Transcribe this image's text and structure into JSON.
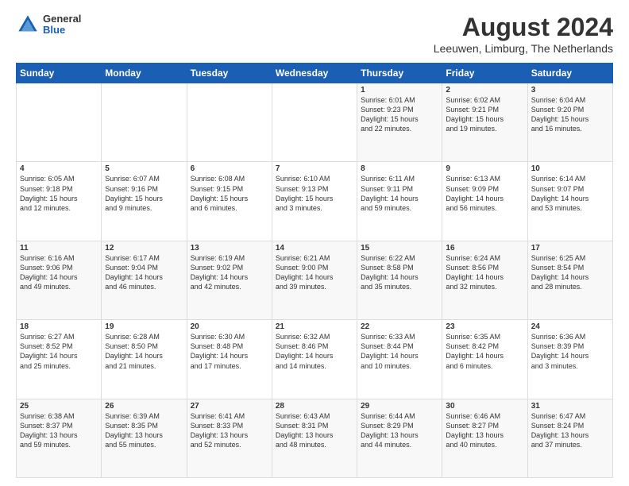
{
  "logo": {
    "general": "General",
    "blue": "Blue"
  },
  "title": "August 2024",
  "subtitle": "Leeuwen, Limburg, The Netherlands",
  "weekdays": [
    "Sunday",
    "Monday",
    "Tuesday",
    "Wednesday",
    "Thursday",
    "Friday",
    "Saturday"
  ],
  "weeks": [
    [
      {
        "day": "",
        "info": ""
      },
      {
        "day": "",
        "info": ""
      },
      {
        "day": "",
        "info": ""
      },
      {
        "day": "",
        "info": ""
      },
      {
        "day": "1",
        "info": "Sunrise: 6:01 AM\nSunset: 9:23 PM\nDaylight: 15 hours\nand 22 minutes."
      },
      {
        "day": "2",
        "info": "Sunrise: 6:02 AM\nSunset: 9:21 PM\nDaylight: 15 hours\nand 19 minutes."
      },
      {
        "day": "3",
        "info": "Sunrise: 6:04 AM\nSunset: 9:20 PM\nDaylight: 15 hours\nand 16 minutes."
      }
    ],
    [
      {
        "day": "4",
        "info": "Sunrise: 6:05 AM\nSunset: 9:18 PM\nDaylight: 15 hours\nand 12 minutes."
      },
      {
        "day": "5",
        "info": "Sunrise: 6:07 AM\nSunset: 9:16 PM\nDaylight: 15 hours\nand 9 minutes."
      },
      {
        "day": "6",
        "info": "Sunrise: 6:08 AM\nSunset: 9:15 PM\nDaylight: 15 hours\nand 6 minutes."
      },
      {
        "day": "7",
        "info": "Sunrise: 6:10 AM\nSunset: 9:13 PM\nDaylight: 15 hours\nand 3 minutes."
      },
      {
        "day": "8",
        "info": "Sunrise: 6:11 AM\nSunset: 9:11 PM\nDaylight: 14 hours\nand 59 minutes."
      },
      {
        "day": "9",
        "info": "Sunrise: 6:13 AM\nSunset: 9:09 PM\nDaylight: 14 hours\nand 56 minutes."
      },
      {
        "day": "10",
        "info": "Sunrise: 6:14 AM\nSunset: 9:07 PM\nDaylight: 14 hours\nand 53 minutes."
      }
    ],
    [
      {
        "day": "11",
        "info": "Sunrise: 6:16 AM\nSunset: 9:06 PM\nDaylight: 14 hours\nand 49 minutes."
      },
      {
        "day": "12",
        "info": "Sunrise: 6:17 AM\nSunset: 9:04 PM\nDaylight: 14 hours\nand 46 minutes."
      },
      {
        "day": "13",
        "info": "Sunrise: 6:19 AM\nSunset: 9:02 PM\nDaylight: 14 hours\nand 42 minutes."
      },
      {
        "day": "14",
        "info": "Sunrise: 6:21 AM\nSunset: 9:00 PM\nDaylight: 14 hours\nand 39 minutes."
      },
      {
        "day": "15",
        "info": "Sunrise: 6:22 AM\nSunset: 8:58 PM\nDaylight: 14 hours\nand 35 minutes."
      },
      {
        "day": "16",
        "info": "Sunrise: 6:24 AM\nSunset: 8:56 PM\nDaylight: 14 hours\nand 32 minutes."
      },
      {
        "day": "17",
        "info": "Sunrise: 6:25 AM\nSunset: 8:54 PM\nDaylight: 14 hours\nand 28 minutes."
      }
    ],
    [
      {
        "day": "18",
        "info": "Sunrise: 6:27 AM\nSunset: 8:52 PM\nDaylight: 14 hours\nand 25 minutes."
      },
      {
        "day": "19",
        "info": "Sunrise: 6:28 AM\nSunset: 8:50 PM\nDaylight: 14 hours\nand 21 minutes."
      },
      {
        "day": "20",
        "info": "Sunrise: 6:30 AM\nSunset: 8:48 PM\nDaylight: 14 hours\nand 17 minutes."
      },
      {
        "day": "21",
        "info": "Sunrise: 6:32 AM\nSunset: 8:46 PM\nDaylight: 14 hours\nand 14 minutes."
      },
      {
        "day": "22",
        "info": "Sunrise: 6:33 AM\nSunset: 8:44 PM\nDaylight: 14 hours\nand 10 minutes."
      },
      {
        "day": "23",
        "info": "Sunrise: 6:35 AM\nSunset: 8:42 PM\nDaylight: 14 hours\nand 6 minutes."
      },
      {
        "day": "24",
        "info": "Sunrise: 6:36 AM\nSunset: 8:39 PM\nDaylight: 14 hours\nand 3 minutes."
      }
    ],
    [
      {
        "day": "25",
        "info": "Sunrise: 6:38 AM\nSunset: 8:37 PM\nDaylight: 13 hours\nand 59 minutes."
      },
      {
        "day": "26",
        "info": "Sunrise: 6:39 AM\nSunset: 8:35 PM\nDaylight: 13 hours\nand 55 minutes."
      },
      {
        "day": "27",
        "info": "Sunrise: 6:41 AM\nSunset: 8:33 PM\nDaylight: 13 hours\nand 52 minutes."
      },
      {
        "day": "28",
        "info": "Sunrise: 6:43 AM\nSunset: 8:31 PM\nDaylight: 13 hours\nand 48 minutes."
      },
      {
        "day": "29",
        "info": "Sunrise: 6:44 AM\nSunset: 8:29 PM\nDaylight: 13 hours\nand 44 minutes."
      },
      {
        "day": "30",
        "info": "Sunrise: 6:46 AM\nSunset: 8:27 PM\nDaylight: 13 hours\nand 40 minutes."
      },
      {
        "day": "31",
        "info": "Sunrise: 6:47 AM\nSunset: 8:24 PM\nDaylight: 13 hours\nand 37 minutes."
      }
    ]
  ]
}
